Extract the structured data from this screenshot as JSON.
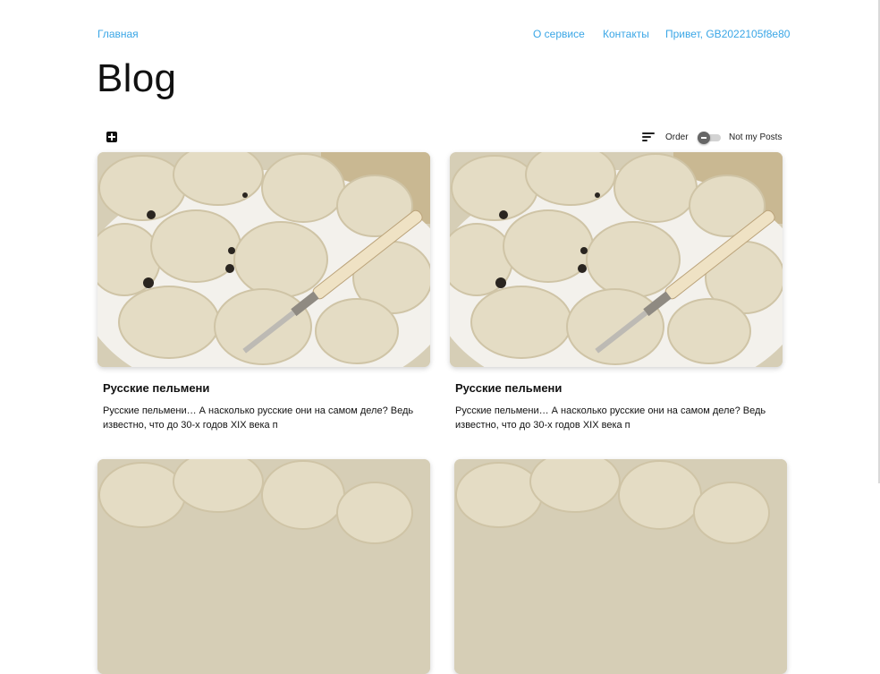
{
  "nav": {
    "home": "Главная",
    "about": "О сервисе",
    "contacts": "Контакты",
    "greeting": "Привет,  GB2022105f8e80"
  },
  "page": {
    "title": "Blog"
  },
  "toolbar": {
    "order_label": "Order",
    "not_my_posts_label": "Not my Posts"
  },
  "posts": [
    {
      "title": "Русские пельмени",
      "excerpt": "Русские пельмени… А насколько русские они на самом деле? Ведь известно, что до 30-х годов XIX века п"
    },
    {
      "title": "Русские пельмени",
      "excerpt": "Русские пельмени… А насколько русские они на самом деле? Ведь известно, что до 30-х годов XIX века п"
    },
    {
      "title": "",
      "excerpt": ""
    },
    {
      "title": "",
      "excerpt": ""
    }
  ],
  "colors": {
    "link": "#3aa6e6",
    "text": "#111111"
  },
  "icons": {
    "add": "plus-square-icon",
    "sort": "sort-lines-icon",
    "toggle": "toggle-switch"
  }
}
